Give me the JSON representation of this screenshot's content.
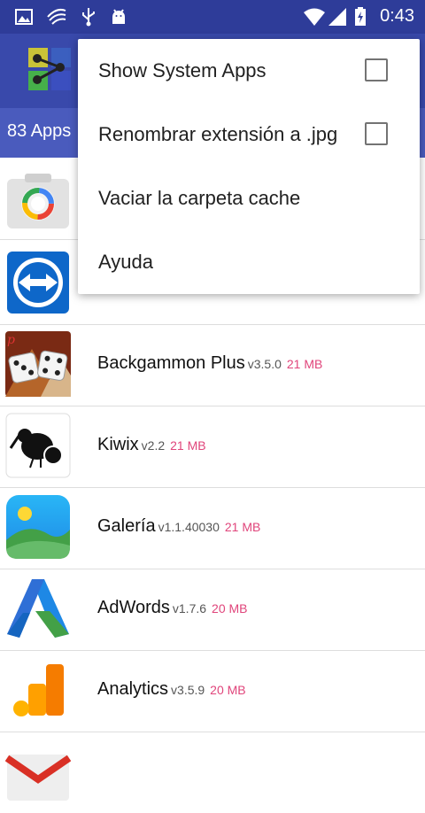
{
  "status_bar": {
    "time": "0:43"
  },
  "header": {
    "app_count": "83 Apps"
  },
  "menu": {
    "items": [
      {
        "label": "Show System Apps",
        "has_checkbox": true,
        "checked": false
      },
      {
        "label": "Renombrar extensión a .jpg",
        "has_checkbox": true,
        "checked": false
      },
      {
        "label": "Vaciar la carpeta cache",
        "has_checkbox": false
      },
      {
        "label": "Ayuda",
        "has_checkbox": false
      }
    ]
  },
  "apps": [
    {
      "name": "",
      "version": "",
      "size": "",
      "icon": "camera-icon"
    },
    {
      "name": "",
      "version": "",
      "size": "",
      "icon": "teamviewer-icon"
    },
    {
      "name": "Backgammon Plus",
      "version": "v3.5.0",
      "size": "21 MB",
      "icon": "backgammon-icon"
    },
    {
      "name": "Kiwix",
      "version": "v2.2",
      "size": "21 MB",
      "icon": "kiwix-icon"
    },
    {
      "name": "Galería",
      "version": "v1.1.40030",
      "size": "21 MB",
      "icon": "gallery-icon"
    },
    {
      "name": "AdWords",
      "version": "v1.7.6",
      "size": "20 MB",
      "icon": "adwords-icon"
    },
    {
      "name": "Analytics",
      "version": "v3.5.9",
      "size": "20 MB",
      "icon": "analytics-icon"
    },
    {
      "name": "",
      "version": "",
      "size": "",
      "icon": "gmail-icon"
    }
  ],
  "colors": {
    "status_bar": "#2e3c99",
    "app_bar": "#3949ab",
    "sub_bar": "#4a5bbd",
    "size_text": "#e0457b"
  }
}
